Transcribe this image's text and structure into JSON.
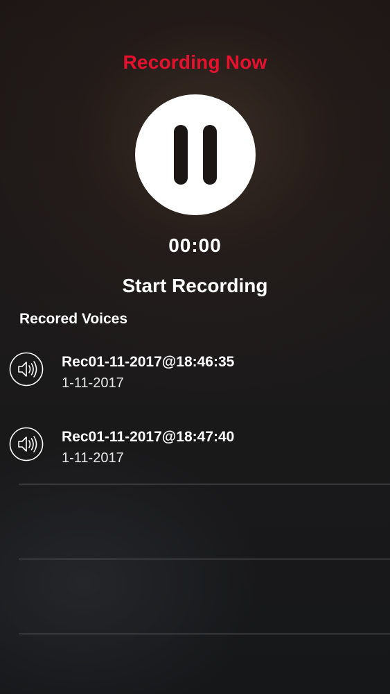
{
  "header": {
    "status": "Recording Now",
    "status_color": "#e8112d"
  },
  "recorder": {
    "button_icon": "pause-icon",
    "timer": "00:00",
    "action_label": "Start Recording"
  },
  "recordings": {
    "title": "Recored Voices",
    "items": [
      {
        "name": "Rec01-11-2017@18:46:35",
        "date": "1-11-2017",
        "icon": "speaker-icon"
      },
      {
        "name": "Rec01-11-2017@18:47:40",
        "date": "1-11-2017",
        "icon": "speaker-icon"
      }
    ]
  }
}
